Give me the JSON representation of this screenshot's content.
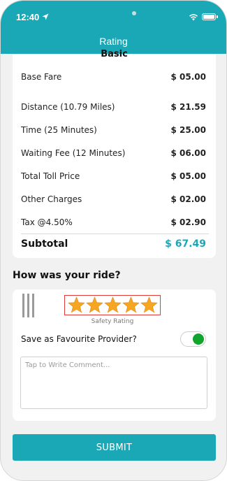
{
  "status_bar": {
    "time": "12:40"
  },
  "header": {
    "title": "Rating"
  },
  "fare": {
    "section_title": "Basic",
    "rows": [
      {
        "label": "Base Fare",
        "value": "$ 05.00"
      },
      {
        "label": "Distance (10.79 Miles)",
        "value": "$ 21.59"
      },
      {
        "label": "Time (25 Minutes)",
        "value": "$ 25.00"
      },
      {
        "label": "Waiting Fee (12 Minutes)",
        "value": "$ 06.00"
      },
      {
        "label": "Total Toll Price",
        "value": "$ 05.00"
      },
      {
        "label": "Other Charges",
        "value": "$ 02.00"
      },
      {
        "label": "Tax @4.50%",
        "value": "$ 02.90"
      }
    ],
    "subtotal": {
      "label": "Subtotal",
      "value": "$ 67.49"
    }
  },
  "rating": {
    "question": "How was your ride?",
    "stars": 5,
    "stars_max": 5,
    "safety_label": "Safety Rating",
    "favourite_label": "Save as Favourite Provider?",
    "favourite_on": true,
    "comment_placeholder": "Tap to Write Comment..."
  },
  "submit_label": "SUBMIT",
  "colors": {
    "accent": "#1ba8b6",
    "star": "#f5a623",
    "highlight_border": "#e53935",
    "toggle_on": "#11a52e"
  }
}
